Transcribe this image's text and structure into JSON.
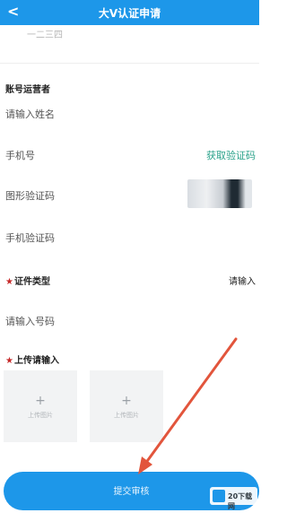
{
  "header": {
    "back_icon": "chevron-left-icon",
    "title": "大V认证申请"
  },
  "top_cut_text": "一二三四",
  "operator": {
    "section_title": "账号运营者",
    "name_placeholder": "请输入姓名",
    "phone_label": "手机号",
    "get_code_label": "获取验证码",
    "captcha_label": "图形验证码",
    "sms_code_label": "手机验证码"
  },
  "certificate": {
    "type_label": "证件类型",
    "type_value": "请输入",
    "number_placeholder": "请输入号码"
  },
  "upload": {
    "label": "上传请输入",
    "boxes": [
      {
        "plus": "+",
        "caption": "上传图片"
      },
      {
        "plus": "+",
        "caption": "上传图片"
      }
    ]
  },
  "submit_label": "提交审核",
  "watermark": "20下载网",
  "colors": {
    "primary": "#1d97e9",
    "link": "#2aa28a",
    "required": "#c62828",
    "annotation_arrow": "#e2553c"
  }
}
